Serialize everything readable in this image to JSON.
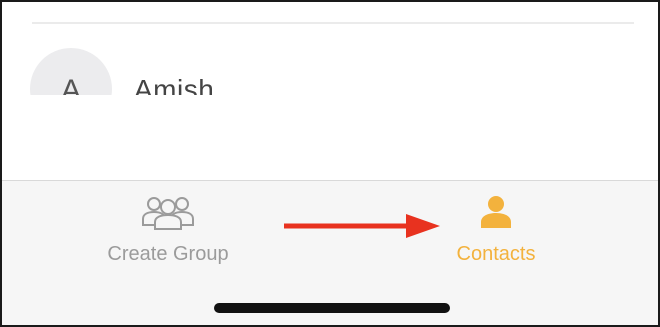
{
  "contact": {
    "initial": "A",
    "name": "Amish"
  },
  "tabbar": {
    "create_group_label": "Create Group",
    "contacts_label": "Contacts",
    "create_group_icon": "group-icon",
    "contacts_icon": "person-icon",
    "active_tab": "Contacts"
  },
  "colors": {
    "active_accent": "#f3b23d",
    "inactive": "#9b9b9b",
    "annotation_arrow": "#e8321f",
    "tabbar_background": "#f6f6f6"
  }
}
